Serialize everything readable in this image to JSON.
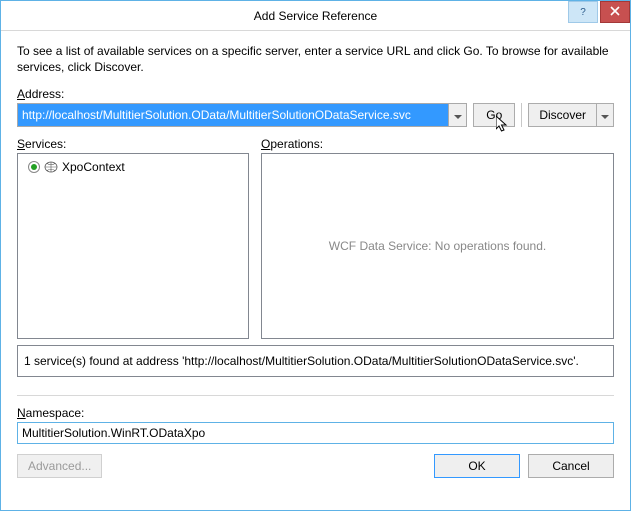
{
  "window": {
    "title": "Add Service Reference",
    "help_tooltip": "Help",
    "close_tooltip": "Close"
  },
  "instructions": "To see a list of available services on a specific server, enter a service URL and click Go. To browse for available services, click Discover.",
  "address": {
    "label": "Address:",
    "value": "http://localhost/MultitierSolution.OData/MultitierSolutionODataService.svc"
  },
  "buttons": {
    "go": "Go",
    "discover": "Discover",
    "ok": "OK",
    "cancel": "Cancel",
    "advanced": "Advanced..."
  },
  "services": {
    "label": "Services:",
    "items": [
      {
        "name": "XpoContext"
      }
    ]
  },
  "operations": {
    "label": "Operations:",
    "empty": "WCF Data Service: No operations found."
  },
  "status": "1 service(s) found at address 'http://localhost/MultitierSolution.OData/MultitierSolutionODataService.svc'.",
  "namespace": {
    "label": "Namespace:",
    "value": "MultitierSolution.WinRT.ODataXpo"
  }
}
